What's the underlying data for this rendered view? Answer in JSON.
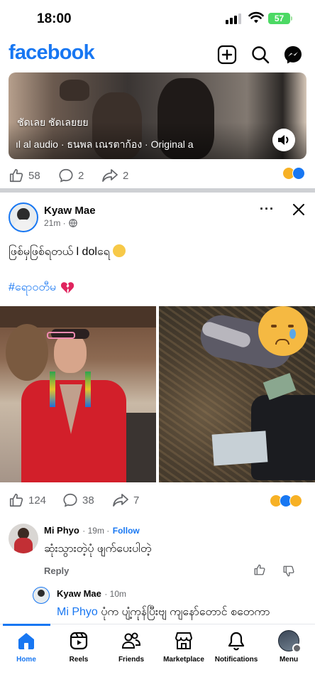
{
  "status_bar": {
    "time": "18:00",
    "battery": "57"
  },
  "header": {
    "logo": "facebook",
    "icons": [
      "add-icon",
      "search-icon",
      "messenger-icon"
    ]
  },
  "reel": {
    "caption": "ชัดเลย ชัดเลยยย",
    "audio": "al audio · ธนพล เณรตาก้อง · Original a",
    "likes": "58",
    "comments": "2",
    "shares": "2"
  },
  "post": {
    "author": "Kyaw Mae",
    "time": "21m ·",
    "text": "ဖြစ်မှဖြစ်ရတယ် l dolရေ",
    "hashtag": "#ရောဝတီမ",
    "likes": "124",
    "comments": "38",
    "shares": "7"
  },
  "comments": [
    {
      "author": "Mi Phyo",
      "time": "· 19m ·",
      "follow": "Follow",
      "text": "ဆုံးသွားတဲ့ပုံ ဖျက်ပေးပါတဲ့",
      "reply": "Reply"
    },
    {
      "author": "Kyaw Mae",
      "time": "· 10m",
      "mention": "Mi Phyo",
      "text": "ပုံက ပျံ့ကုန်ပြီးဗျ ကျနော်တောင် စတေကာ"
    }
  ],
  "nav": [
    {
      "label": "Home",
      "icon": "home-icon"
    },
    {
      "label": "Reels",
      "icon": "reels-icon"
    },
    {
      "label": "Friends",
      "icon": "friends-icon"
    },
    {
      "label": "Marketplace",
      "icon": "marketplace-icon"
    },
    {
      "label": "Notifications",
      "icon": "bell-icon"
    },
    {
      "label": "Menu",
      "icon": "menu-avatar-icon"
    }
  ],
  "colors": {
    "brand": "#1877f2",
    "secondary_text": "#65676b",
    "divider": "#ced0d4"
  }
}
